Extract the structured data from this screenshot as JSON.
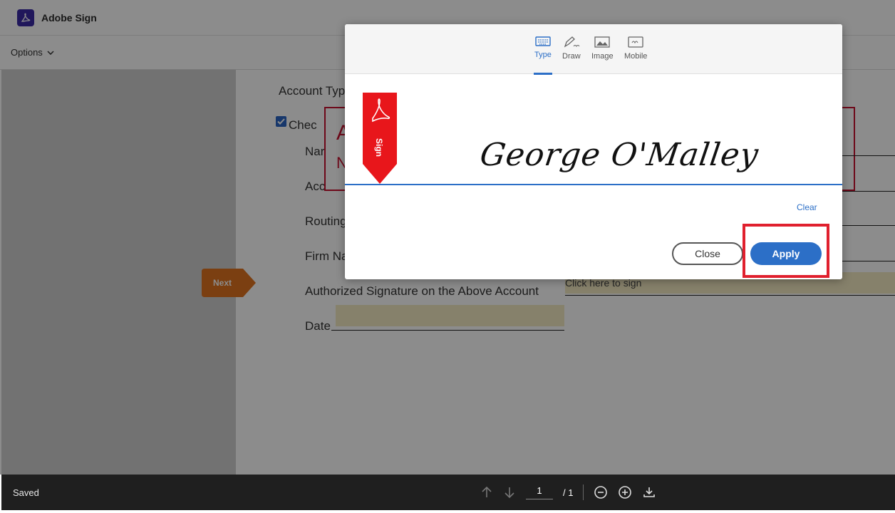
{
  "app": {
    "title": "Adobe Sign"
  },
  "toolbar": {
    "options_label": "Options"
  },
  "document": {
    "account_type": "Account Typ",
    "check_label": "Chec",
    "name_label": "Nar",
    "account_label": "Acc",
    "routing_label": "Routing",
    "firm_label": "Firm Na",
    "auth_sig_label": "Authorized Signature on the Above Account",
    "date_label": "Date",
    "click_to_sign": "Click here to sign",
    "agreement_a": "A",
    "agreement_n": "N"
  },
  "next_button": {
    "label": "Next"
  },
  "dialog": {
    "tabs": [
      {
        "label": "Type",
        "icon": "keyboard-icon",
        "active": true
      },
      {
        "label": "Draw",
        "icon": "pen-icon",
        "active": false
      },
      {
        "label": "Image",
        "icon": "image-icon",
        "active": false
      },
      {
        "label": "Mobile",
        "icon": "mobile-icon",
        "active": false
      }
    ],
    "ribbon_text": "Sign",
    "signature_text": "George O'Malley",
    "clear_label": "Clear",
    "close_label": "Close",
    "apply_label": "Apply"
  },
  "bottom": {
    "status": "Saved",
    "page_current": "1",
    "page_total": "/ 1"
  },
  "colors": {
    "accent": "#2c6fc7",
    "highlight": "#e0202e",
    "ribbon": "#e8161b",
    "next": "#e0741f"
  }
}
